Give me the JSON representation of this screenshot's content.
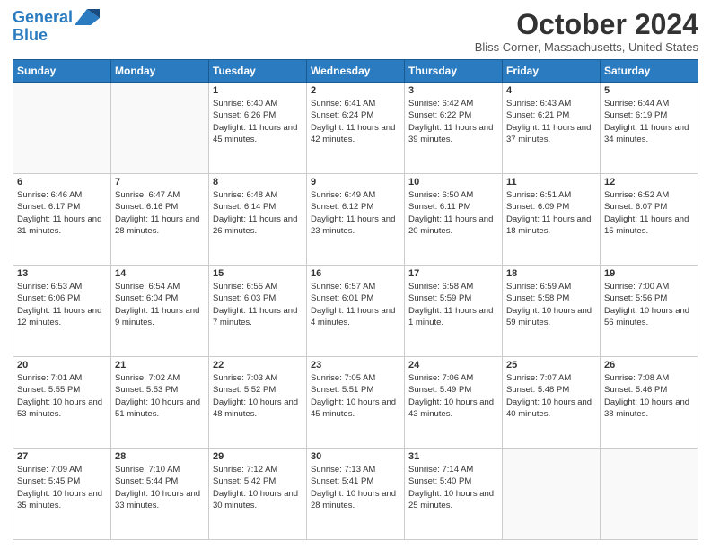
{
  "header": {
    "logo_line1": "General",
    "logo_line2": "Blue",
    "title": "October 2024",
    "subtitle": "Bliss Corner, Massachusetts, United States"
  },
  "days_of_week": [
    "Sunday",
    "Monday",
    "Tuesday",
    "Wednesday",
    "Thursday",
    "Friday",
    "Saturday"
  ],
  "weeks": [
    [
      {
        "day": "",
        "sunrise": "",
        "sunset": "",
        "daylight": ""
      },
      {
        "day": "",
        "sunrise": "",
        "sunset": "",
        "daylight": ""
      },
      {
        "day": "1",
        "sunrise": "Sunrise: 6:40 AM",
        "sunset": "Sunset: 6:26 PM",
        "daylight": "Daylight: 11 hours and 45 minutes."
      },
      {
        "day": "2",
        "sunrise": "Sunrise: 6:41 AM",
        "sunset": "Sunset: 6:24 PM",
        "daylight": "Daylight: 11 hours and 42 minutes."
      },
      {
        "day": "3",
        "sunrise": "Sunrise: 6:42 AM",
        "sunset": "Sunset: 6:22 PM",
        "daylight": "Daylight: 11 hours and 39 minutes."
      },
      {
        "day": "4",
        "sunrise": "Sunrise: 6:43 AM",
        "sunset": "Sunset: 6:21 PM",
        "daylight": "Daylight: 11 hours and 37 minutes."
      },
      {
        "day": "5",
        "sunrise": "Sunrise: 6:44 AM",
        "sunset": "Sunset: 6:19 PM",
        "daylight": "Daylight: 11 hours and 34 minutes."
      }
    ],
    [
      {
        "day": "6",
        "sunrise": "Sunrise: 6:46 AM",
        "sunset": "Sunset: 6:17 PM",
        "daylight": "Daylight: 11 hours and 31 minutes."
      },
      {
        "day": "7",
        "sunrise": "Sunrise: 6:47 AM",
        "sunset": "Sunset: 6:16 PM",
        "daylight": "Daylight: 11 hours and 28 minutes."
      },
      {
        "day": "8",
        "sunrise": "Sunrise: 6:48 AM",
        "sunset": "Sunset: 6:14 PM",
        "daylight": "Daylight: 11 hours and 26 minutes."
      },
      {
        "day": "9",
        "sunrise": "Sunrise: 6:49 AM",
        "sunset": "Sunset: 6:12 PM",
        "daylight": "Daylight: 11 hours and 23 minutes."
      },
      {
        "day": "10",
        "sunrise": "Sunrise: 6:50 AM",
        "sunset": "Sunset: 6:11 PM",
        "daylight": "Daylight: 11 hours and 20 minutes."
      },
      {
        "day": "11",
        "sunrise": "Sunrise: 6:51 AM",
        "sunset": "Sunset: 6:09 PM",
        "daylight": "Daylight: 11 hours and 18 minutes."
      },
      {
        "day": "12",
        "sunrise": "Sunrise: 6:52 AM",
        "sunset": "Sunset: 6:07 PM",
        "daylight": "Daylight: 11 hours and 15 minutes."
      }
    ],
    [
      {
        "day": "13",
        "sunrise": "Sunrise: 6:53 AM",
        "sunset": "Sunset: 6:06 PM",
        "daylight": "Daylight: 11 hours and 12 minutes."
      },
      {
        "day": "14",
        "sunrise": "Sunrise: 6:54 AM",
        "sunset": "Sunset: 6:04 PM",
        "daylight": "Daylight: 11 hours and 9 minutes."
      },
      {
        "day": "15",
        "sunrise": "Sunrise: 6:55 AM",
        "sunset": "Sunset: 6:03 PM",
        "daylight": "Daylight: 11 hours and 7 minutes."
      },
      {
        "day": "16",
        "sunrise": "Sunrise: 6:57 AM",
        "sunset": "Sunset: 6:01 PM",
        "daylight": "Daylight: 11 hours and 4 minutes."
      },
      {
        "day": "17",
        "sunrise": "Sunrise: 6:58 AM",
        "sunset": "Sunset: 5:59 PM",
        "daylight": "Daylight: 11 hours and 1 minute."
      },
      {
        "day": "18",
        "sunrise": "Sunrise: 6:59 AM",
        "sunset": "Sunset: 5:58 PM",
        "daylight": "Daylight: 10 hours and 59 minutes."
      },
      {
        "day": "19",
        "sunrise": "Sunrise: 7:00 AM",
        "sunset": "Sunset: 5:56 PM",
        "daylight": "Daylight: 10 hours and 56 minutes."
      }
    ],
    [
      {
        "day": "20",
        "sunrise": "Sunrise: 7:01 AM",
        "sunset": "Sunset: 5:55 PM",
        "daylight": "Daylight: 10 hours and 53 minutes."
      },
      {
        "day": "21",
        "sunrise": "Sunrise: 7:02 AM",
        "sunset": "Sunset: 5:53 PM",
        "daylight": "Daylight: 10 hours and 51 minutes."
      },
      {
        "day": "22",
        "sunrise": "Sunrise: 7:03 AM",
        "sunset": "Sunset: 5:52 PM",
        "daylight": "Daylight: 10 hours and 48 minutes."
      },
      {
        "day": "23",
        "sunrise": "Sunrise: 7:05 AM",
        "sunset": "Sunset: 5:51 PM",
        "daylight": "Daylight: 10 hours and 45 minutes."
      },
      {
        "day": "24",
        "sunrise": "Sunrise: 7:06 AM",
        "sunset": "Sunset: 5:49 PM",
        "daylight": "Daylight: 10 hours and 43 minutes."
      },
      {
        "day": "25",
        "sunrise": "Sunrise: 7:07 AM",
        "sunset": "Sunset: 5:48 PM",
        "daylight": "Daylight: 10 hours and 40 minutes."
      },
      {
        "day": "26",
        "sunrise": "Sunrise: 7:08 AM",
        "sunset": "Sunset: 5:46 PM",
        "daylight": "Daylight: 10 hours and 38 minutes."
      }
    ],
    [
      {
        "day": "27",
        "sunrise": "Sunrise: 7:09 AM",
        "sunset": "Sunset: 5:45 PM",
        "daylight": "Daylight: 10 hours and 35 minutes."
      },
      {
        "day": "28",
        "sunrise": "Sunrise: 7:10 AM",
        "sunset": "Sunset: 5:44 PM",
        "daylight": "Daylight: 10 hours and 33 minutes."
      },
      {
        "day": "29",
        "sunrise": "Sunrise: 7:12 AM",
        "sunset": "Sunset: 5:42 PM",
        "daylight": "Daylight: 10 hours and 30 minutes."
      },
      {
        "day": "30",
        "sunrise": "Sunrise: 7:13 AM",
        "sunset": "Sunset: 5:41 PM",
        "daylight": "Daylight: 10 hours and 28 minutes."
      },
      {
        "day": "31",
        "sunrise": "Sunrise: 7:14 AM",
        "sunset": "Sunset: 5:40 PM",
        "daylight": "Daylight: 10 hours and 25 minutes."
      },
      {
        "day": "",
        "sunrise": "",
        "sunset": "",
        "daylight": ""
      },
      {
        "day": "",
        "sunrise": "",
        "sunset": "",
        "daylight": ""
      }
    ]
  ]
}
